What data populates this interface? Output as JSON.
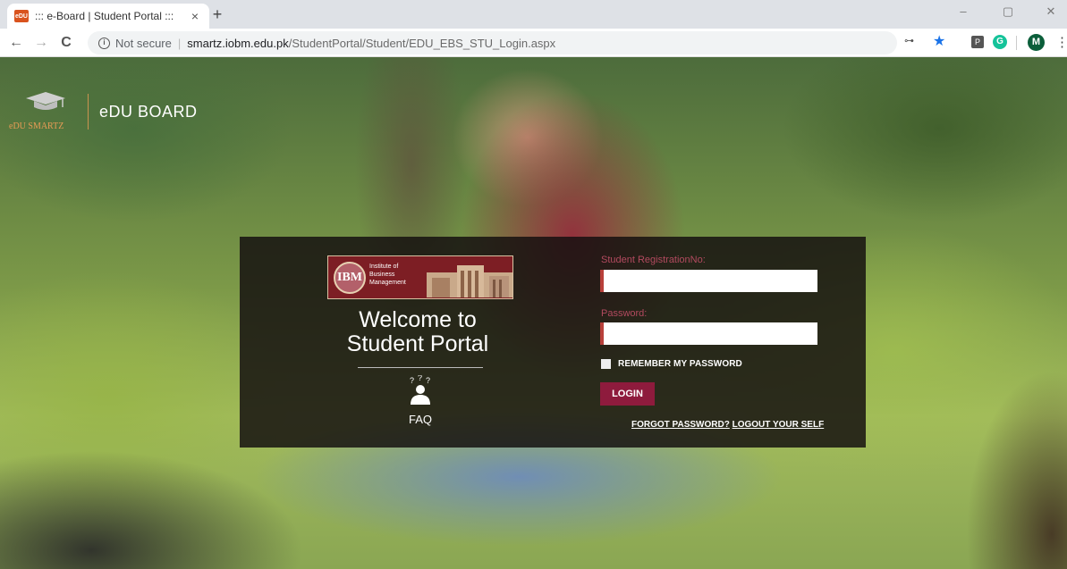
{
  "browser": {
    "tab_title": "::: e-Board | Student Portal :::",
    "favicon_text": "eDU",
    "tab_close": "×",
    "new_tab": "+",
    "security_label": "Not secure",
    "separator": "|",
    "url_host": "smartz.iobm.edu.pk",
    "url_path": "/StudentPortal/Student/EDU_EBS_STU_Login.aspx",
    "avatar_letter": "M",
    "minimize": "–",
    "restore": "▢",
    "close": "✕",
    "back": "←",
    "forward": "→",
    "reload": "C",
    "star": "★",
    "key": "⊶",
    "ext_pocket": "P",
    "ext_grammarly": "G",
    "menu": "⋮"
  },
  "brand": {
    "small_text": "eDU SMARTZ",
    "title": "eDU BOARD"
  },
  "institute": {
    "emblem_text": "IBM",
    "name_lines": "Institute of Business Management"
  },
  "welcome": {
    "line1": "Welcome to",
    "line2": "Student Portal"
  },
  "faq": {
    "label": "FAQ"
  },
  "form": {
    "reg_label": "Student RegistrationNo:",
    "reg_value": "",
    "password_label": "Password:",
    "password_value": "",
    "remember_label": "REMEMBER MY PASSWORD",
    "login_label": "LOGIN",
    "forgot_label": "FORGOT PASSWORD?",
    "logout_label": "LOGOUT YOUR SELF"
  },
  "colors": {
    "accent": "#8e1b3d",
    "label": "#b24a5f",
    "input_border": "#b8403b",
    "brand_orange": "#e99b55"
  }
}
